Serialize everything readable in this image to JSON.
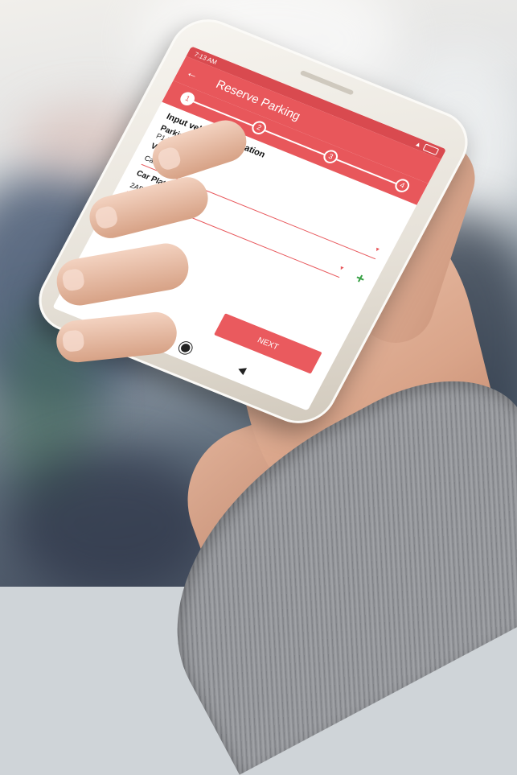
{
  "status_bar": {
    "time": "7:13 AM"
  },
  "app_bar": {
    "title": "Reserve Parking"
  },
  "stepper": {
    "steps": [
      "1",
      "2",
      "3",
      "4"
    ],
    "active_step": 1
  },
  "form": {
    "section_title": "Input vehicle information",
    "parking_label": "Parking",
    "parking_value": "P1 jurn-e",
    "vehicle_type_label": "Vehicle Type",
    "vehicle_type_value": "Car",
    "car_plate_label": "Car Plate",
    "car_plate_value": "2ABC123"
  },
  "next_button": "NEXT",
  "colors": {
    "accent": "#e8575b",
    "add_icon": "#36a043"
  }
}
